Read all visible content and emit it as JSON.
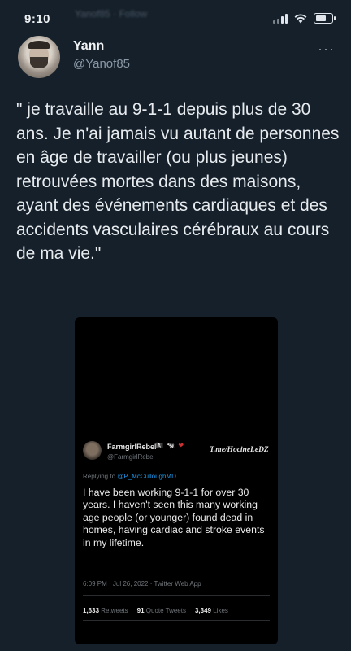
{
  "status_bar": {
    "time": "9:10",
    "blurred_text": "Yanof85 · Follow",
    "battery_level": 0.75
  },
  "author": {
    "name": "Yann",
    "handle": "@Yanof85",
    "more_icon": "···"
  },
  "tweet_text": "\" je travaille au 9-1-1 depuis plus de 30 ans. Je n'ai jamais vu autant de personnes en âge de travailler (ou plus jeunes) retrouvées mortes dans des maisons, ayant des événements cardiaques et des accidents vasculaires cérébraux au cours de ma vie.\"",
  "embedded": {
    "name": "FarmgirlRebel",
    "emojis": "🏴‍☠️ 🐄 ❤",
    "handle": "@FarmgirlRebel",
    "watermark": "T.me/HocineLeDZ",
    "replying_prefix": "Replying to",
    "replying_to": "@P_McCulloughMD",
    "text": "I have been working 9-1-1 for over 30 years. I haven't seen this many working age people (or younger) found dead in homes, having cardiac and stroke events in my lifetime.",
    "meta": "6:09 PM · Jul 26, 2022 · Twitter Web App",
    "stats": [
      {
        "count": "1,633",
        "label": "Retweets"
      },
      {
        "count": "91",
        "label": "Quote Tweets"
      },
      {
        "count": "3,349",
        "label": "Likes"
      }
    ]
  },
  "colors": {
    "background": "#15202b",
    "link": "#1d9bf0",
    "secondary_text": "#8b98a5"
  }
}
